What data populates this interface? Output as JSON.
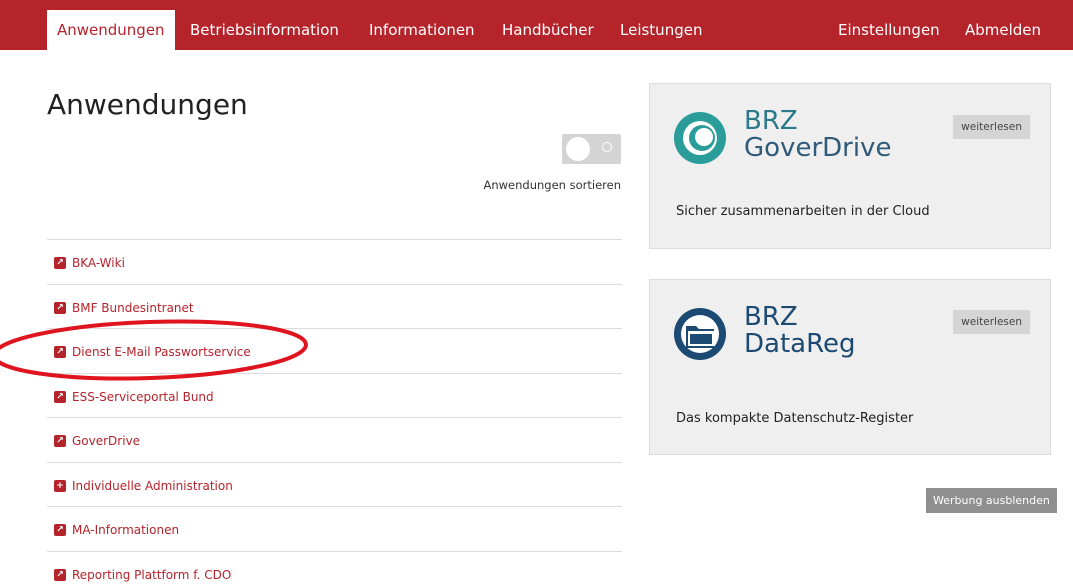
{
  "nav": {
    "left": [
      "Anwendungen",
      "Betriebsinformation",
      "Informationen",
      "Handbücher",
      "Leistungen"
    ],
    "right": [
      "Einstellungen",
      "Abmelden"
    ],
    "active": "Anwendungen"
  },
  "page": {
    "title": "Anwendungen",
    "sort_toggle_state": "off",
    "sort_label": "Anwendungen sortieren"
  },
  "applications": [
    {
      "label": "BKA-Wiki",
      "icon": "external-link-icon"
    },
    {
      "label": "BMF Bundesintranet",
      "icon": "external-link-icon"
    },
    {
      "label": "Dienst E-Mail Passwortservice",
      "icon": "external-link-icon"
    },
    {
      "label": "ESS-Serviceportal Bund",
      "icon": "external-link-icon"
    },
    {
      "label": "GoverDrive",
      "icon": "external-link-icon"
    },
    {
      "label": "Individuelle Administration",
      "icon": "plus-icon"
    },
    {
      "label": "MA-Informationen",
      "icon": "external-link-icon"
    },
    {
      "label": "Reporting Plattform f. CDO",
      "icon": "external-link-icon"
    }
  ],
  "promos": [
    {
      "brand_line1": "BRZ",
      "brand_line2": "GoverDrive",
      "button": "weiterlesen",
      "text": "Sicher zusammenarbeiten in der Cloud",
      "logo": "goverdrive-logo"
    },
    {
      "brand_line1": "BRZ",
      "brand_line2": "DataReg",
      "button": "weiterlesen",
      "text": "Das kompakte Datenschutz-Register",
      "logo": "datareg-logo"
    }
  ],
  "hide_ads_label": "Werbung ausblenden",
  "colors": {
    "brand_red": "#b5232b",
    "annotation_red": "#e0141e",
    "promo_bg": "#efefef",
    "goverdrive_teal": "#2a9d9a",
    "datareg_blue": "#1c4a73"
  }
}
